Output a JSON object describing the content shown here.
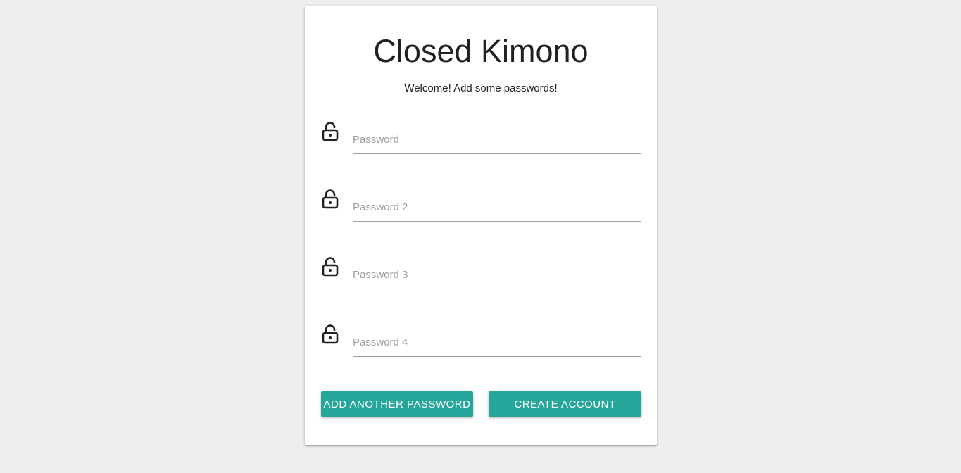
{
  "app": {
    "title": "Closed Kimono",
    "subtitle": "Welcome! Add some passwords!"
  },
  "fields": [
    {
      "placeholder": "Password",
      "value": "",
      "icon": "lock-icon"
    },
    {
      "placeholder": "Password 2",
      "value": "",
      "icon": "lock-icon"
    },
    {
      "placeholder": "Password 3",
      "value": "",
      "icon": "lock-icon"
    },
    {
      "placeholder": "Password 4",
      "value": "",
      "icon": "lock-icon"
    }
  ],
  "actions": {
    "add_password_label": "Add another password",
    "create_account_label": "Create account"
  },
  "colors": {
    "accent": "#26a69a",
    "background": "#eeeeee",
    "card": "#ffffff",
    "text": "#212121",
    "placeholder": "#9e9e9e"
  }
}
